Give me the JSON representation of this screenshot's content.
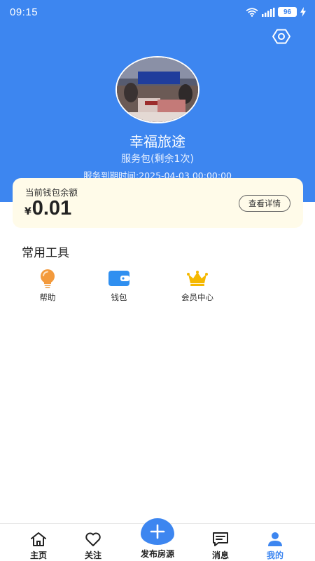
{
  "status_bar": {
    "time": "09:15",
    "battery": "96",
    "icons": [
      "wifi-icon",
      "signal-icon",
      "battery-icon",
      "charging-icon"
    ]
  },
  "header": {
    "eye_icon": "eye-icon"
  },
  "profile": {
    "name": "幸福旅途",
    "package": "服务包(剩余1次)",
    "expiry": "服务到期时间:2025-04-03 00:00:00"
  },
  "balance": {
    "label": "当前钱包余额",
    "currency": "¥",
    "amount": "0.01",
    "details_button": "查看详情"
  },
  "tools": {
    "title": "常用工具",
    "items": [
      {
        "label": "帮助",
        "icon": "help-bulb-icon",
        "color": "#f39a3c"
      },
      {
        "label": "钱包",
        "icon": "wallet-icon",
        "color": "#2f8ff0"
      },
      {
        "label": "会员中心",
        "icon": "crown-icon",
        "color": "#f5b800"
      }
    ]
  },
  "tabbar": {
    "items": [
      {
        "label": "主页",
        "icon": "home-icon"
      },
      {
        "label": "关注",
        "icon": "heart-icon"
      },
      {
        "label": "发布房源",
        "icon": "plus-icon"
      },
      {
        "label": "消息",
        "icon": "message-icon"
      },
      {
        "label": "我的",
        "icon": "user-icon",
        "active": true
      }
    ]
  },
  "colors": {
    "primary": "#3d86f0",
    "card": "#fffbe9"
  }
}
